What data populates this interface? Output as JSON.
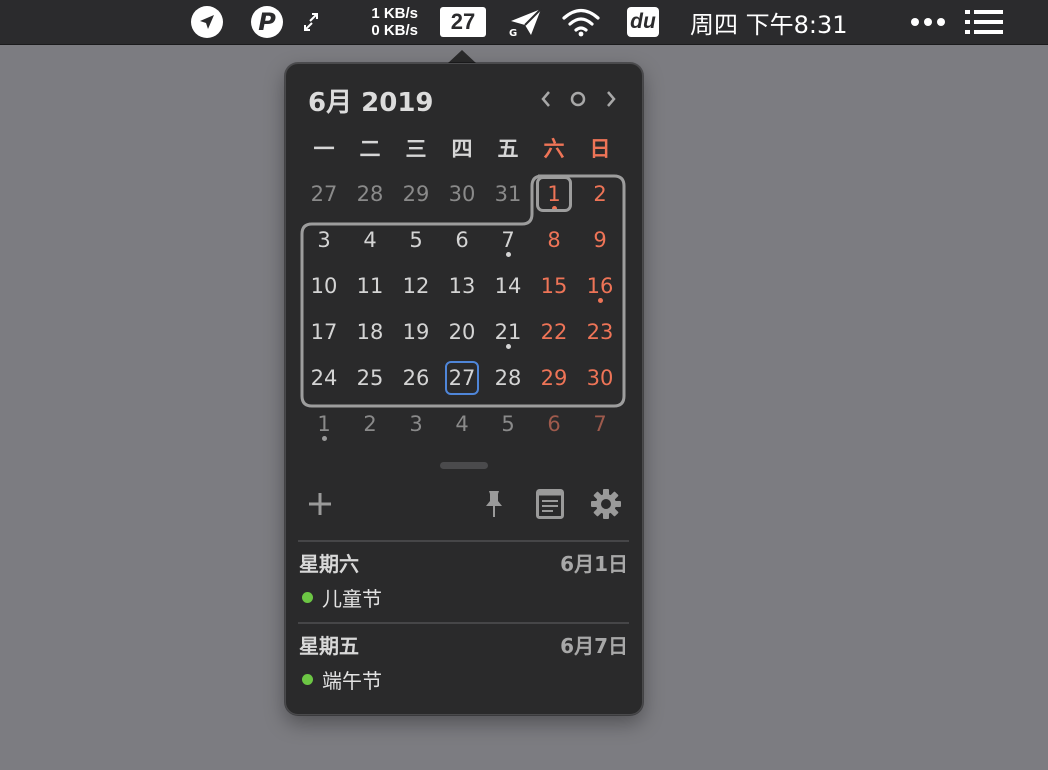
{
  "menubar": {
    "net_up": "1 KB/s",
    "net_down": "0 KB/s",
    "date_badge": "27",
    "vpn_sub": "G",
    "du_label": "du",
    "clock": "周四 下午8:31"
  },
  "calendar": {
    "title": "6月 2019",
    "weekdays": [
      "一",
      "二",
      "三",
      "四",
      "五",
      "六",
      "日"
    ],
    "weeks": [
      [
        "27",
        "28",
        "29",
        "30",
        "31",
        "1",
        "2"
      ],
      [
        "3",
        "4",
        "5",
        "6",
        "7",
        "8",
        "9"
      ],
      [
        "10",
        "11",
        "12",
        "13",
        "14",
        "15",
        "16"
      ],
      [
        "17",
        "18",
        "19",
        "20",
        "21",
        "22",
        "23"
      ],
      [
        "24",
        "25",
        "26",
        "27",
        "28",
        "29",
        "30"
      ],
      [
        "1",
        "2",
        "3",
        "4",
        "5",
        "6",
        "7"
      ]
    ],
    "today": "27"
  },
  "events": [
    {
      "weekday": "星期六",
      "date": "6月1日",
      "name": "儿童节",
      "color": "#6cc644"
    },
    {
      "weekday": "星期五",
      "date": "6月7日",
      "name": "端午节",
      "color": "#6cc644"
    }
  ],
  "colors": {
    "weekend": "#ee7457",
    "today_outline": "#4f86d9",
    "event_dot": "#6cc644"
  }
}
